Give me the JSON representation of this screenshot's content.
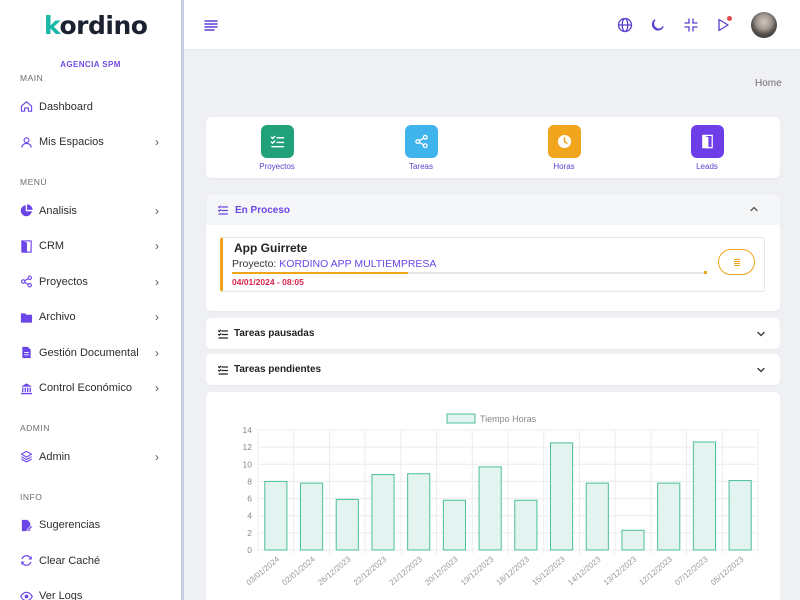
{
  "brand": {
    "name": "kordino",
    "agency": "AGENCIA SPM"
  },
  "sidebar": {
    "sections": [
      {
        "title": "MAIN",
        "items": [
          {
            "label": "Dashboard",
            "icon": "home-icon",
            "chevron": false
          },
          {
            "label": "Mis Espacios",
            "icon": "user-icon",
            "chevron": true
          }
        ]
      },
      {
        "title": "MENÚ",
        "items": [
          {
            "label": "Analisis",
            "icon": "pie-chart-icon",
            "chevron": true
          },
          {
            "label": "CRM",
            "icon": "door-icon",
            "chevron": true
          },
          {
            "label": "Proyectos",
            "icon": "share-icon",
            "chevron": true
          },
          {
            "label": "Archivo",
            "icon": "folder-icon",
            "chevron": true
          },
          {
            "label": "Gestión Documental",
            "icon": "document-icon",
            "chevron": true
          },
          {
            "label": "Control Económico",
            "icon": "bank-icon",
            "chevron": true
          }
        ]
      },
      {
        "title": "ADMIN",
        "items": [
          {
            "label": "Admin",
            "icon": "layers-icon",
            "chevron": true
          }
        ]
      },
      {
        "title": "INFO",
        "items": [
          {
            "label": "Sugerencias",
            "icon": "edit-document-icon",
            "chevron": false
          },
          {
            "label": "Clear Caché",
            "icon": "refresh-icon",
            "chevron": false
          },
          {
            "label": "Ver Logs",
            "icon": "eye-icon",
            "chevron": false
          }
        ]
      }
    ]
  },
  "breadcrumb": {
    "home": "Home"
  },
  "quick_links": [
    {
      "label": "Proyectos",
      "color": "#21a179",
      "icon": "checklist-icon"
    },
    {
      "label": "Tareas",
      "color": "#3fb3ec",
      "icon": "share-icon"
    },
    {
      "label": "Horas",
      "color": "#f0a51c",
      "icon": "clock-icon"
    },
    {
      "label": "Leads",
      "color": "#6d3ee8",
      "icon": "door-icon"
    }
  ],
  "in_progress": {
    "title": "En Proceso",
    "task": {
      "name": "App Guirrete",
      "project_label": "Proyecto:",
      "project": "KORDINO APP MULTIEMPRESA",
      "datetime": "04/01/2024 - 08:05",
      "progress": 0.37
    }
  },
  "paused": {
    "title": "Tareas pausadas"
  },
  "pending": {
    "title": "Tareas pendientes"
  },
  "chart_data": {
    "type": "bar",
    "legend": "Tiempo Horas",
    "categories": [
      "03/01/2024",
      "02/01/2024",
      "26/12/2023",
      "22/12/2023",
      "21/12/2023",
      "20/12/2023",
      "19/12/2023",
      "18/12/2023",
      "15/12/2023",
      "14/12/2023",
      "13/12/2023",
      "12/12/2023",
      "07/12/2023",
      "05/12/2023"
    ],
    "values": [
      8.0,
      7.8,
      5.9,
      8.8,
      8.9,
      5.8,
      9.7,
      5.8,
      12.5,
      7.8,
      2.3,
      7.8,
      12.6,
      8.1
    ],
    "ylim": [
      0,
      14
    ],
    "yticks": [
      0,
      2,
      4,
      6,
      8,
      10,
      12,
      14
    ],
    "bar_fill": "#e3f3ef",
    "bar_stroke": "#4cbf9b"
  },
  "accent": "#6b45e8"
}
